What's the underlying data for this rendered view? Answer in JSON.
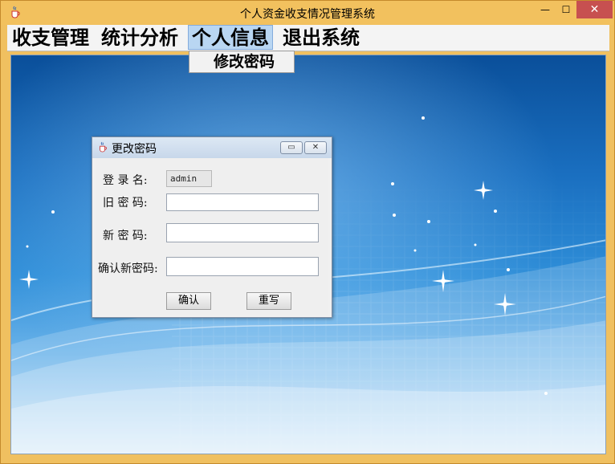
{
  "window": {
    "title": "个人资金收支情况管理系统",
    "app_icon": "java-cup-icon",
    "controls": {
      "minimize": "—",
      "maximize": "☐",
      "close": "✕"
    }
  },
  "menubar": {
    "items": [
      {
        "label": "收支管理"
      },
      {
        "label": "统计分析"
      },
      {
        "label": "个人信息"
      },
      {
        "label": "退出系统"
      }
    ],
    "active_index": 2,
    "submenu": {
      "items": [
        {
          "label": "修改密码"
        }
      ]
    }
  },
  "dialog": {
    "title": "更改密码",
    "icon": "java-cup-icon",
    "controls": {
      "minimize": "▭",
      "close": "✕"
    },
    "login_label": "登 录 名:",
    "login_value": "admin",
    "old_password_label": "旧 密 码:",
    "old_password_value": "",
    "new_password_label": "新 密 码:",
    "new_password_value": "",
    "confirm_password_label": "确认新密码:",
    "confirm_password_value": "",
    "confirm_button": "确认",
    "reset_button": "重写"
  },
  "colors": {
    "window_frame": "#f2c15e",
    "menu_active": "#b9d6f2",
    "close_button": "#c75050",
    "background_top": "#0a4f9a",
    "background_bottom": "#cfe7f8"
  }
}
